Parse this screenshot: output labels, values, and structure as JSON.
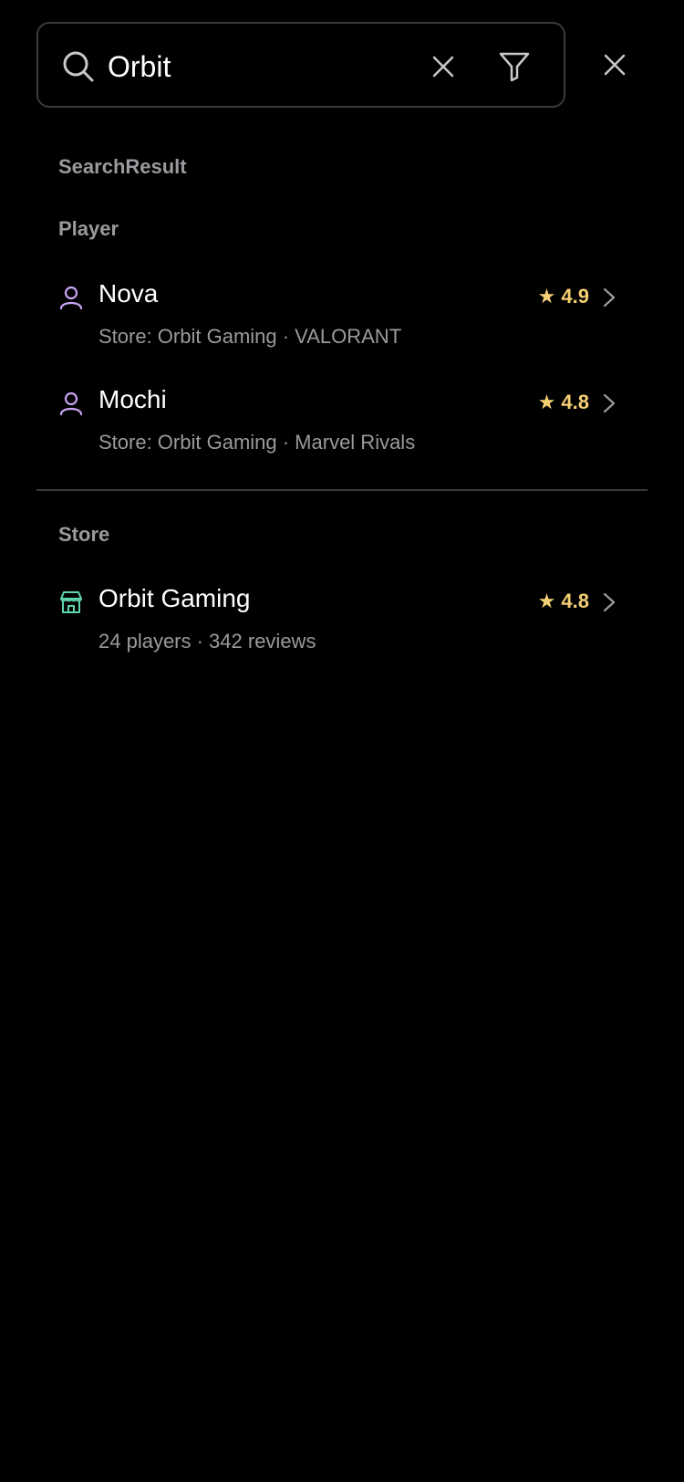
{
  "search": {
    "value": "Orbit",
    "placeholder": "Search"
  },
  "results": {
    "heading": "SearchResult",
    "players": {
      "heading": "Player",
      "items": [
        {
          "name": "Nova",
          "meta": "Store: Orbit Gaming · VALORANT",
          "rating": "★ 4.9"
        },
        {
          "name": "Mochi",
          "meta": "Store: Orbit Gaming · Marvel Rivals",
          "rating": "★ 4.8"
        }
      ]
    },
    "stores": {
      "heading": "Store",
      "items": [
        {
          "name": "Orbit Gaming",
          "meta": "24 players · 342 reviews",
          "rating": "★ 4.8"
        }
      ]
    }
  },
  "icons": {
    "search": "search-icon",
    "clear": "close-icon",
    "filter": "funnel-icon",
    "close": "close-icon",
    "player": "user-icon",
    "store": "storefront-icon",
    "chevron": "chevron-right-icon"
  },
  "colors": {
    "background": "#000000",
    "border": "#3a3a3c",
    "muted_text": "#9a9a9e",
    "rating": "#f5cf74",
    "player_icon": "#c9a5f5",
    "store_icon": "#5fd6b0"
  }
}
